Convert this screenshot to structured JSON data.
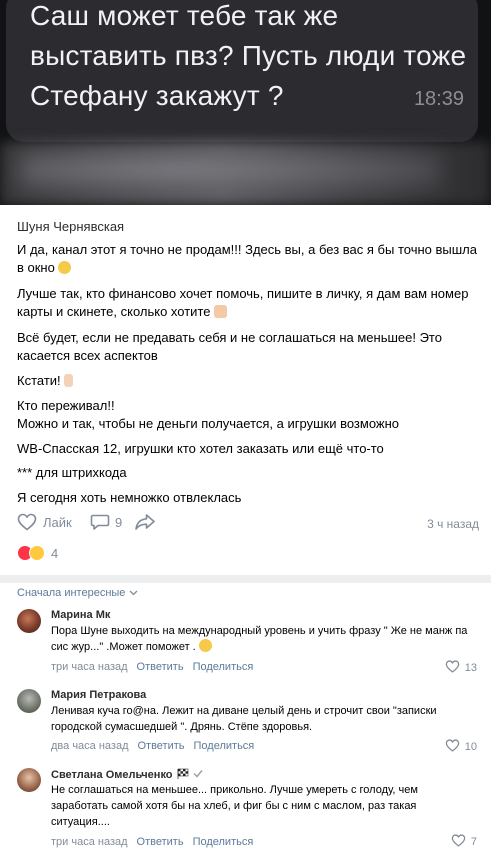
{
  "screenshot": {
    "message": "Саш может тебе так же выставить пвз? Пусть люди тоже Стефану закажут ?",
    "time": "18:39"
  },
  "post": {
    "author": "Шуня Чернявская",
    "paragraphs": [
      "И да, канал этот я точно не продам!!! Здесь вы, а без вас я бы точно вышла в окно",
      "Лучше так, кто финансово хочет помочь, пишите в личку, я дам вам номер карты и скинете, сколько хотите",
      "Всё будет, если не предавать себя и не соглашаться на меньшее! Это касается всех аспектов",
      "Кстати!",
      "Кто переживал!!",
      "Можно и так, чтобы не деньги получается, а игрушки возможно",
      "WB-Спасская 12, игрушки кто хотел заказать или ещё что-то",
      "*** для штрихкода",
      "Я сегодня хоть немножко отвлеклась"
    ],
    "like_label": "Лайк",
    "comments_count": "9",
    "time_ago": "3 ч назад",
    "reactions_count": "4"
  },
  "comments_section": {
    "sort_label": "Сначала интересные"
  },
  "comments": [
    {
      "name": "Марина Мк",
      "text": "Пора Шуне выходить на международный уровень и учить фразу \" Же не манж па сис жур...\" .Может поможет .",
      "time": "три часа назад",
      "reply_label": "Ответить",
      "share_label": "Поделиться",
      "likes": "13"
    },
    {
      "name": "Мария Петракова",
      "text": "Ленивая куча го@на. Лежит на диване целый день и строчит свои \"записки городской сумасшедшей \". Дрянь. Стёпе здоровья.",
      "time": "два часа назад",
      "reply_label": "Ответить",
      "share_label": "Поделиться",
      "likes": "10"
    },
    {
      "name": "Светлана Омельченко",
      "text": "Не соглашаться на меньшее... прикольно. Лучше умереть с голоду, чем заработать самой хотя бы на хлеб, и фиг бы с ним с маслом, раз такая ситуация....",
      "time": "три часа назад",
      "reply_label": "Ответить",
      "share_label": "Поделиться",
      "likes": "7"
    }
  ],
  "colors": {
    "link": "#5c7a99",
    "meta": "#818c99",
    "heart": "#ff3347",
    "divider": "#edeef0"
  },
  "icons": [
    "heart-outline-icon",
    "comment-icon",
    "share-arrow-icon",
    "chevron-down-icon",
    "checkered-flag-icon",
    "verified-check-icon"
  ]
}
